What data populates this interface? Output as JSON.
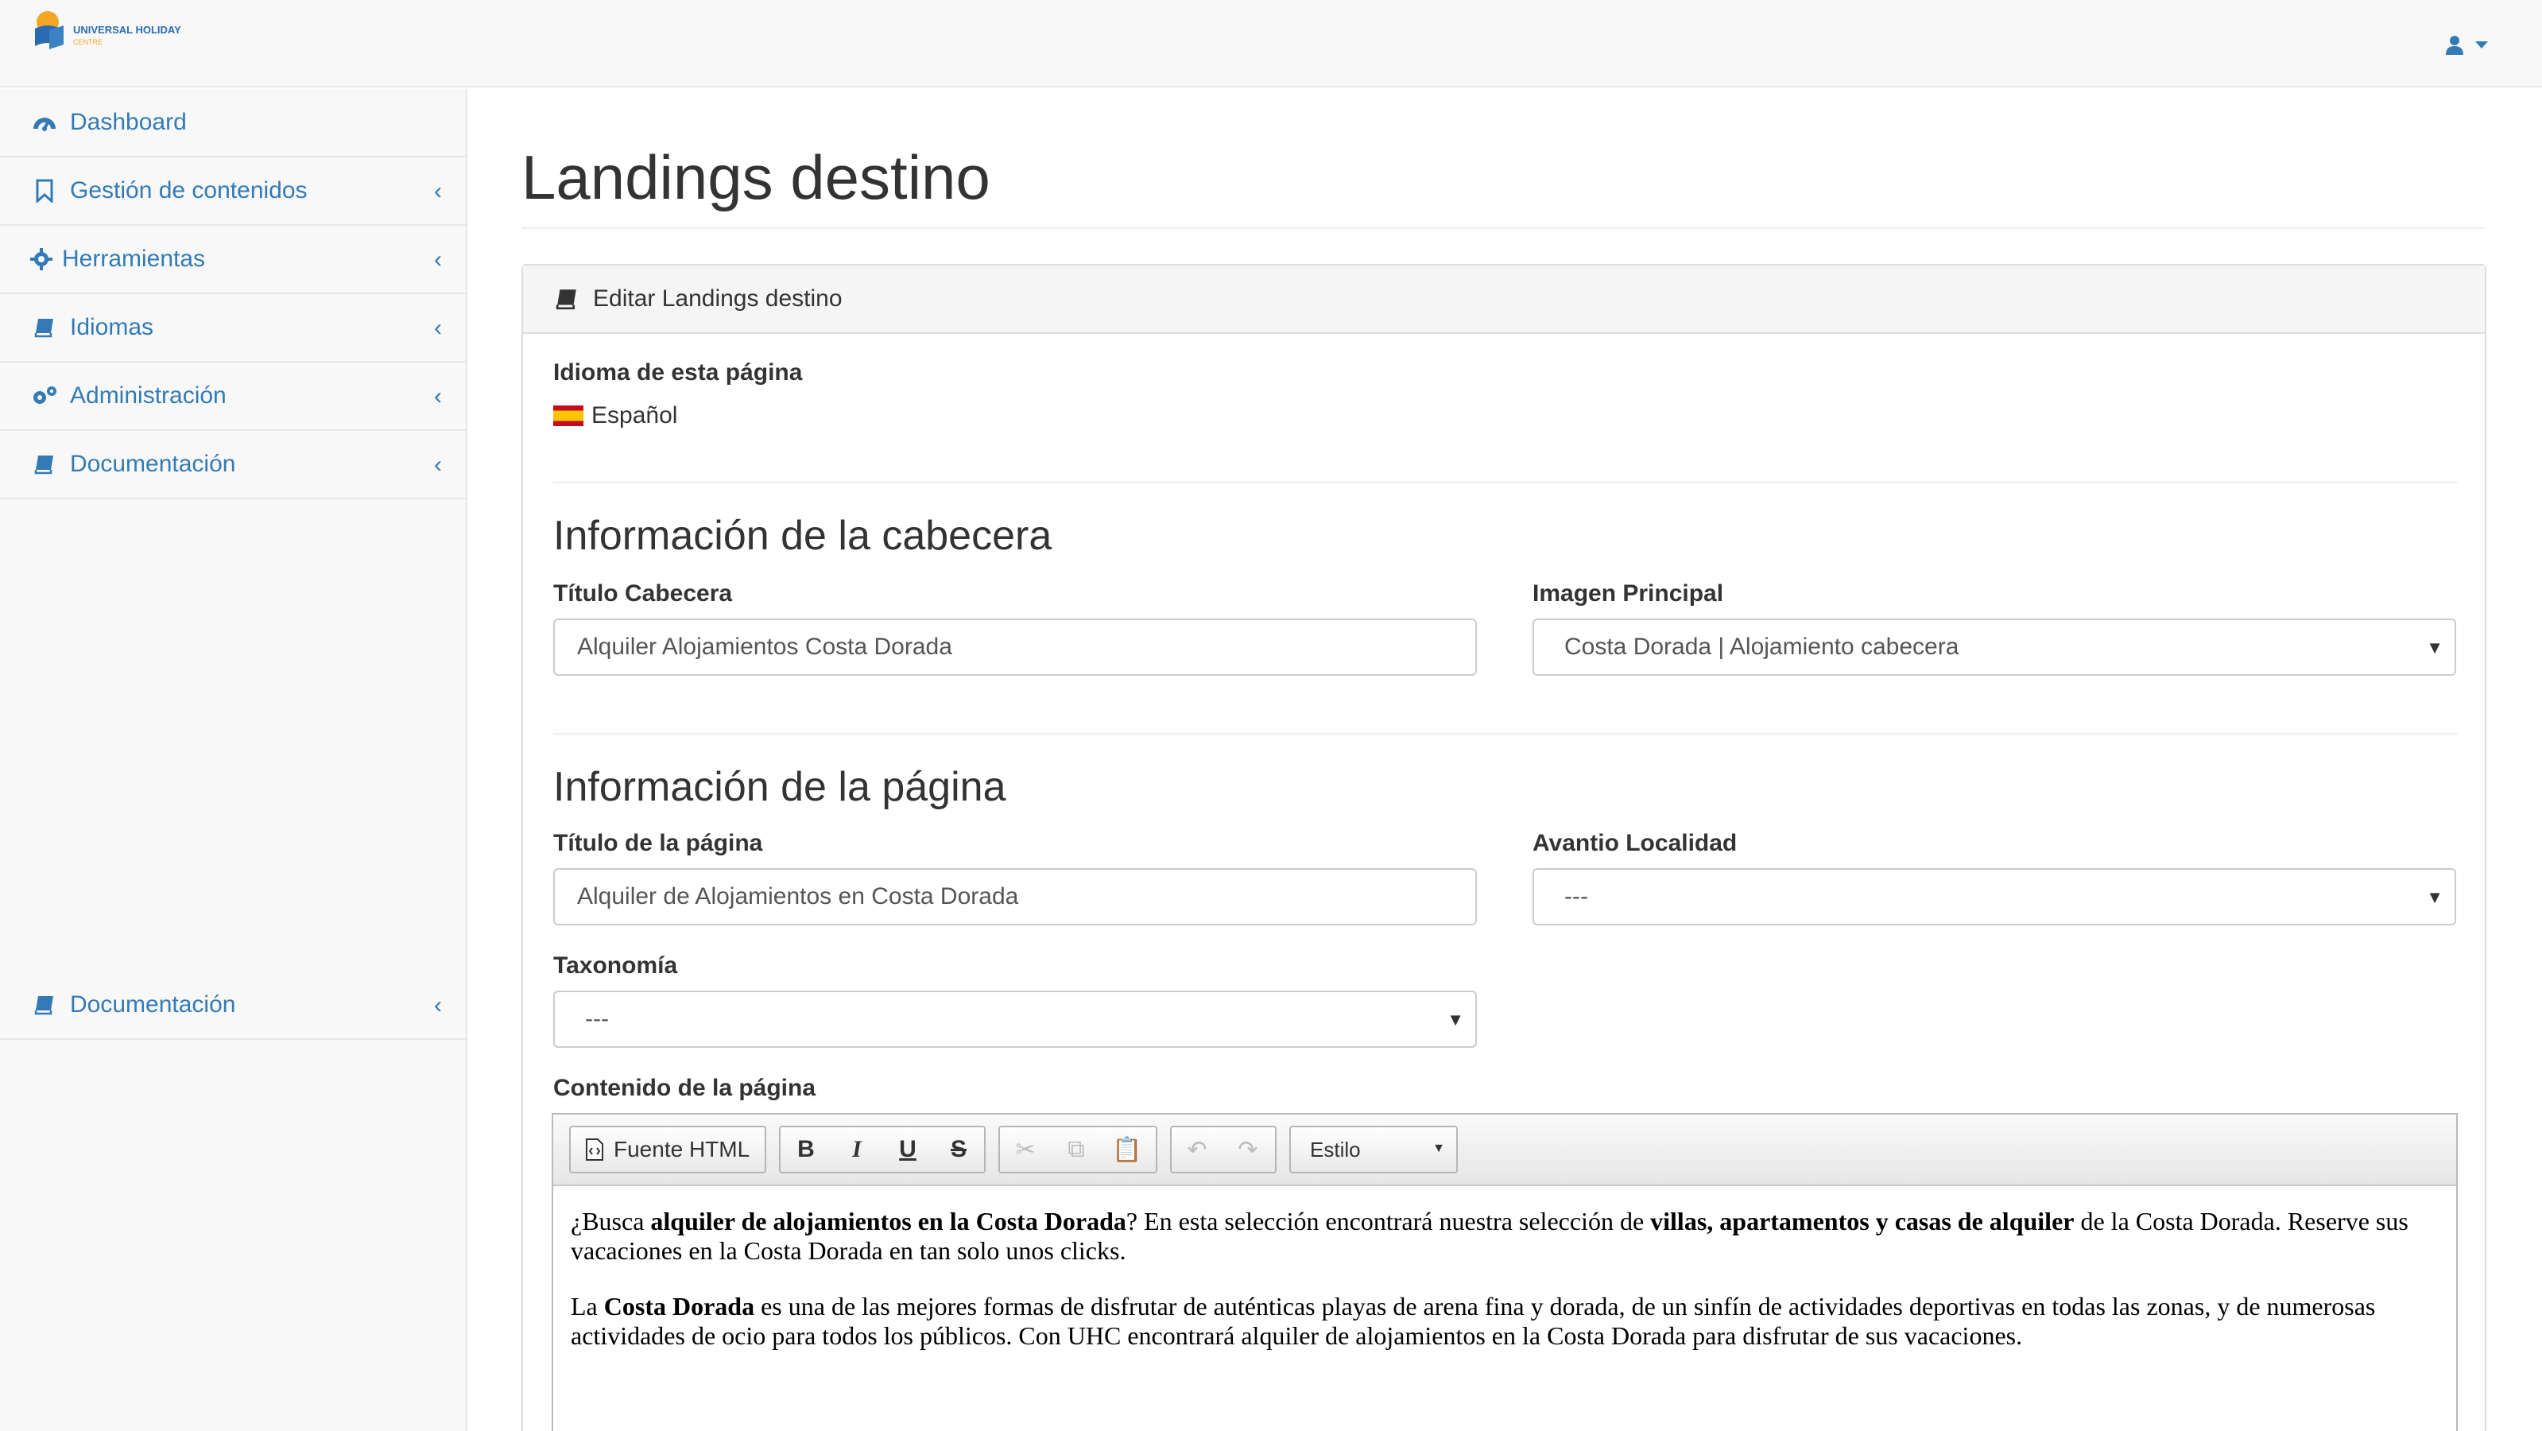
{
  "header": {
    "logo_text": "UNIVERSAL HOLIDAY CENTRE"
  },
  "sidebar": {
    "items": [
      {
        "label": "Dashboard",
        "icon": "dashboard-icon"
      },
      {
        "label": "Gestión de contenidos",
        "icon": "bookmark-icon"
      },
      {
        "label": "Herramientas",
        "icon": "gear-icon"
      },
      {
        "label": "Idiomas",
        "icon": "book-icon"
      },
      {
        "label": "Administración",
        "icon": "gears-icon"
      },
      {
        "label": "Documentación",
        "icon": "book-icon"
      }
    ],
    "bottom_item": {
      "label": "Documentación",
      "icon": "book-icon"
    }
  },
  "page": {
    "title": "Landings destino"
  },
  "panel": {
    "heading": "Editar Landings destino",
    "language_label": "Idioma de esta página",
    "language_value": "Español",
    "section_header": "Información de la cabecera",
    "titulo_cabecera_label": "Título Cabecera",
    "titulo_cabecera_value": "Alquiler Alojamientos Costa Dorada",
    "imagen_principal_label": "Imagen Principal",
    "imagen_principal_value": "Costa Dorada | Alojamiento cabecera",
    "section_page": "Información de la página",
    "titulo_pagina_label": "Título de la página",
    "titulo_pagina_value": "Alquiler de Alojamientos en Costa Dorada",
    "avantio_label": "Avantio Localidad",
    "avantio_value": "---",
    "taxonomia_label": "Taxonomía",
    "taxonomia_value": "---",
    "contenido_label": "Contenido de la página"
  },
  "editor": {
    "source_button": "Fuente HTML",
    "style_select": "Estilo",
    "content": {
      "p1": [
        "¿Busca ",
        "alquiler de alojamientos en la Costa Dorada",
        "? En esta selección encontrará nuestra selección de ",
        "villas, apartamentos y casas de alquiler",
        " de la Costa Dorada.  Reserve sus vacaciones en la Costa Dorada en tan solo unos clicks."
      ],
      "p2": [
        "La ",
        "Costa Dorada",
        " es una de las mejores formas de disfrutar de auténticas playas de arena fina y dorada, de un sinfín de actividades deportivas en todas las zonas, y de numerosas actividades de ocio para todos los públicos. Con UHC encontrará alquiler de alojamientos en la Costa Dorada para disfrutar de sus vacaciones."
      ]
    }
  },
  "colors": {
    "link": "#337ab7",
    "sidebar_bg": "#f8f8f8",
    "border": "#e7e7e7"
  }
}
